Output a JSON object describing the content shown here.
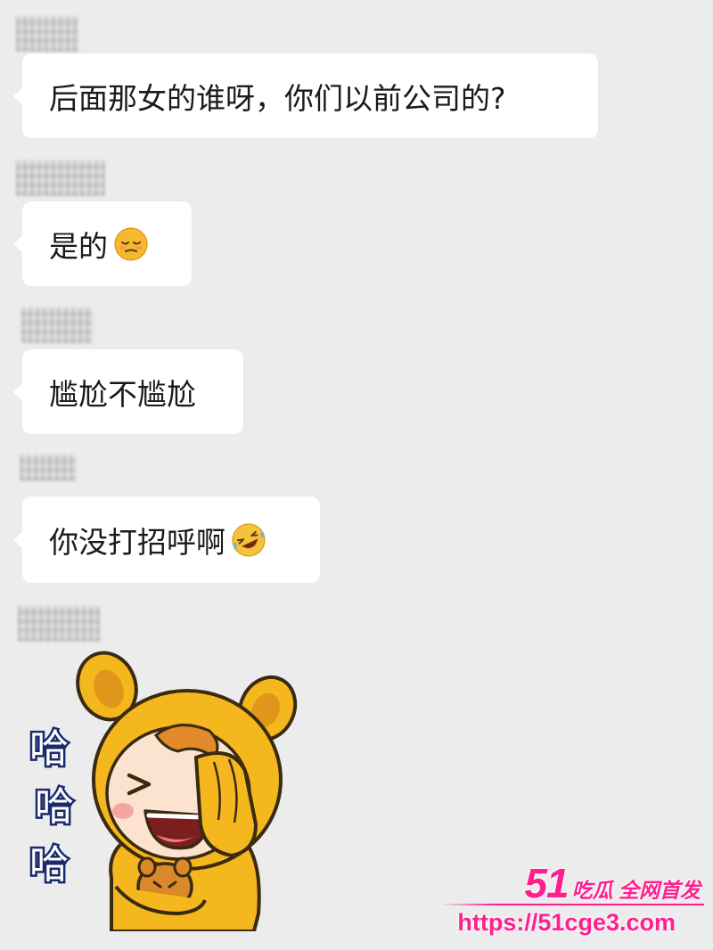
{
  "chat": {
    "messages": [
      {
        "text": "后面那女的谁呀，你们以前公司的?",
        "emoji": ""
      },
      {
        "text": "是的",
        "emoji": "sleepy-face-emoji"
      },
      {
        "text": "尴尬不尴尬",
        "emoji": ""
      },
      {
        "text": "你没打招呼啊",
        "emoji": "rolling-laughing-emoji"
      }
    ],
    "sticker": {
      "caption": "哈哈哈",
      "chars": [
        "哈",
        "哈",
        "哈"
      ]
    }
  },
  "watermark": {
    "number": "51",
    "text": "吃瓜 全网首发",
    "url": "https://51cge3.com",
    "color": "#ff1f8e"
  }
}
